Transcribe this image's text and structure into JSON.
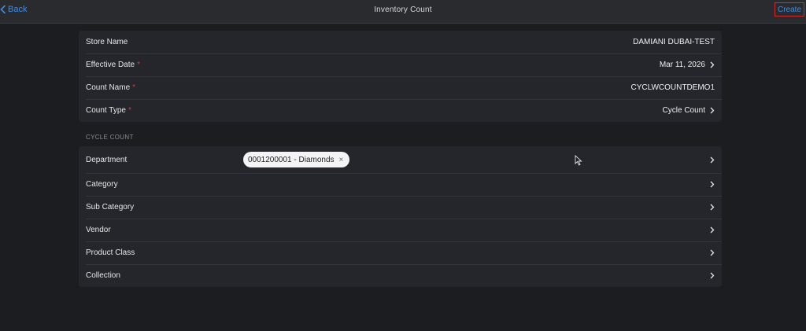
{
  "nav": {
    "back_label": "Back",
    "title": "Inventory Count",
    "create_label": "Create"
  },
  "details": [
    {
      "label": "Store Name",
      "required": false,
      "value": "DAMIANI DUBAI-TEST",
      "chevron": false
    },
    {
      "label": "Effective Date",
      "required": true,
      "value": "Mar 11, 2026",
      "chevron": true
    },
    {
      "label": "Count Name",
      "required": true,
      "value": "CYCLWCOUNTDEMO1",
      "chevron": false
    },
    {
      "label": "Count Type",
      "required": true,
      "value": "Cycle Count",
      "chevron": true
    }
  ],
  "required_marker": "*",
  "section_header": "CYCLE COUNT",
  "filters": {
    "department": {
      "label": "Department",
      "chip": "0001200001 - Diamonds",
      "chip_remove": "×"
    },
    "category": {
      "label": "Category"
    },
    "sub_category": {
      "label": "Sub Category"
    },
    "vendor": {
      "label": "Vendor"
    },
    "product_class": {
      "label": "Product Class"
    },
    "collection": {
      "label": "Collection"
    }
  },
  "colors": {
    "accent": "#3a8ee6",
    "required": "#d03a3a",
    "highlight_border": "#d02a2a"
  },
  "icons": {
    "back": "chevron-left-icon",
    "row": "chevron-right-icon",
    "cursor": "mouse-pointer-icon"
  }
}
